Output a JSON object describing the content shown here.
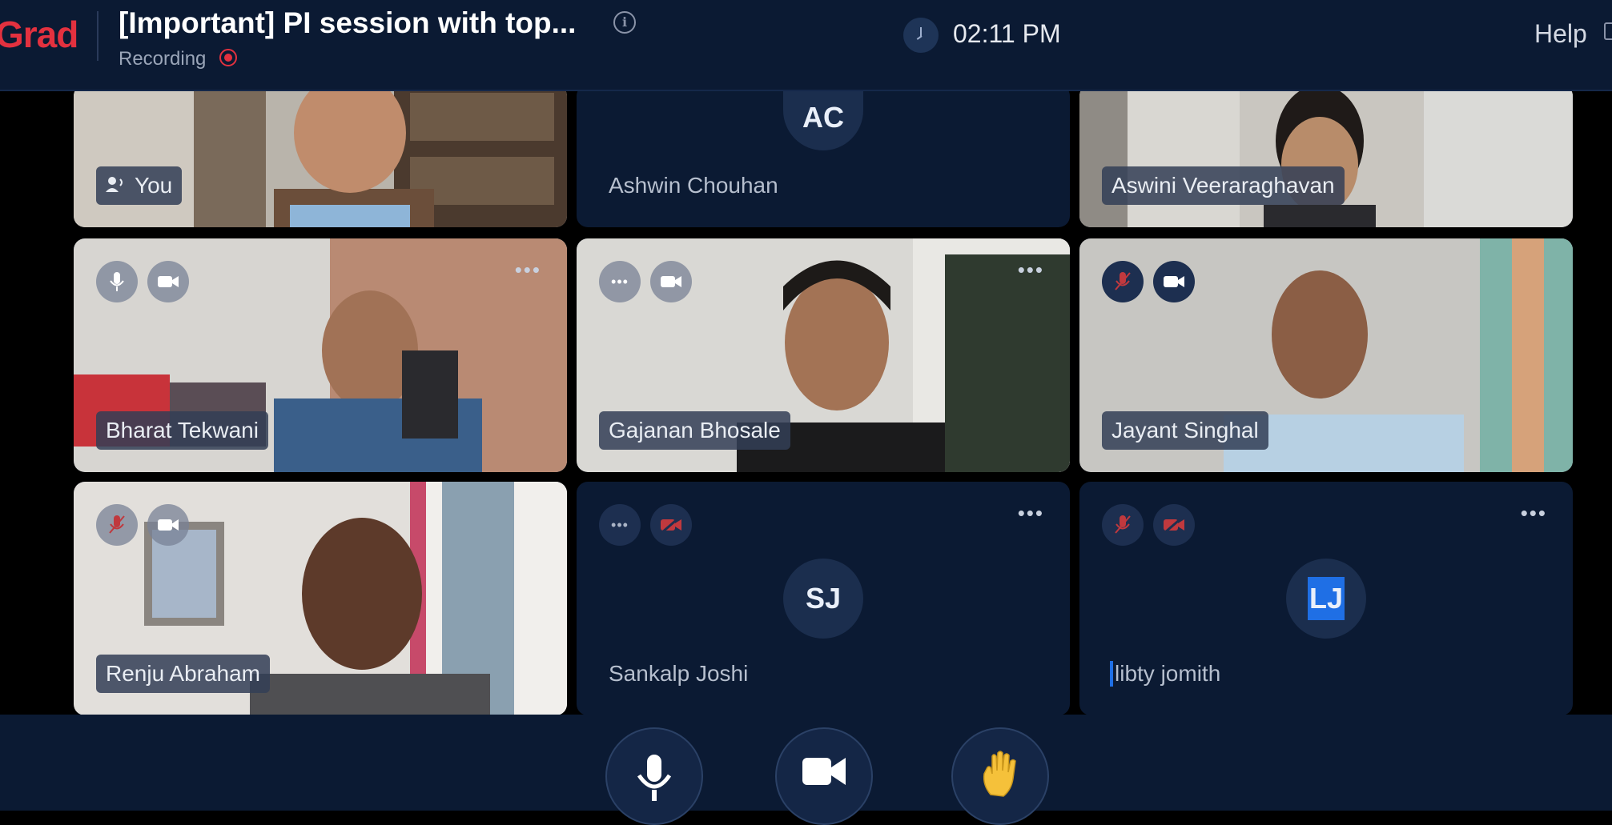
{
  "app": {
    "brand": "Grad",
    "title": "[Important] PI session with top...",
    "recording_label": "Recording",
    "time": "02:11 PM",
    "help_label": "Help"
  },
  "colors": {
    "topbar_bg": "#0b1a33",
    "brand_red": "#e3313f",
    "tile_bg": "#0b1a33",
    "avatar_bg": "#1b2e4e",
    "muted_red": "#c0393e"
  },
  "participants": [
    {
      "name": "You",
      "video": true,
      "initials": ""
    },
    {
      "name": "Ashwin Chouhan",
      "video": false,
      "initials": "AC"
    },
    {
      "name": "Aswini Veeraraghavan",
      "video": true,
      "initials": ""
    },
    {
      "name": "Bharat Tekwani",
      "video": true,
      "mic": "on",
      "cam": "on"
    },
    {
      "name": "Gajanan Bhosale",
      "video": true,
      "mic": "connecting",
      "cam": "on"
    },
    {
      "name": "Jayant Singhal",
      "video": true,
      "mic": "muted",
      "cam": "on"
    },
    {
      "name": "Renju Abraham",
      "video": true,
      "mic": "muted",
      "cam": "on"
    },
    {
      "name": "Sankalp Joshi",
      "video": false,
      "initials": "SJ",
      "mic": "connecting",
      "cam": "off"
    },
    {
      "name": "libty jomith",
      "video": false,
      "initials": "LJ",
      "mic": "muted",
      "cam": "off"
    }
  ],
  "controls": {
    "mic": "microphone-icon",
    "camera": "video-camera-icon",
    "raise_hand": "raise-hand-icon"
  }
}
